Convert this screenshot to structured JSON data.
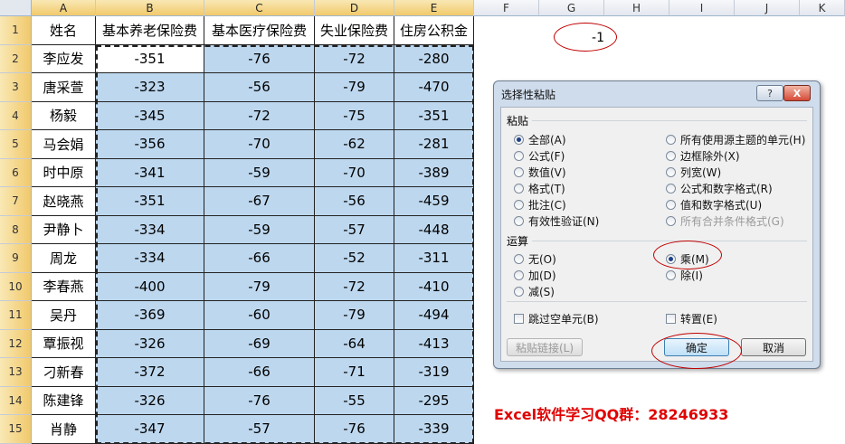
{
  "spreadsheet": {
    "columns": [
      "A",
      "B",
      "C",
      "D",
      "E",
      "F",
      "G",
      "H",
      "I",
      "J",
      "K"
    ],
    "rows": [
      "1",
      "2",
      "3",
      "4",
      "5",
      "6",
      "7",
      "8",
      "9",
      "10",
      "11",
      "12",
      "13",
      "14",
      "15"
    ],
    "headers": [
      "姓名",
      "基本养老保险费",
      "基本医疗保险费",
      "失业保险费",
      "住房公积金"
    ],
    "data": [
      [
        "李应发",
        "-351",
        "-76",
        "-72",
        "-280"
      ],
      [
        "唐采萱",
        "-323",
        "-56",
        "-79",
        "-470"
      ],
      [
        "杨毅",
        "-345",
        "-72",
        "-75",
        "-351"
      ],
      [
        "马会娟",
        "-356",
        "-70",
        "-62",
        "-281"
      ],
      [
        "时中原",
        "-341",
        "-59",
        "-70",
        "-389"
      ],
      [
        "赵晓燕",
        "-351",
        "-67",
        "-56",
        "-459"
      ],
      [
        "尹静卜",
        "-334",
        "-59",
        "-57",
        "-448"
      ],
      [
        "周龙",
        "-334",
        "-66",
        "-52",
        "-311"
      ],
      [
        "李春燕",
        "-400",
        "-79",
        "-72",
        "-410"
      ],
      [
        "吴丹",
        "-369",
        "-60",
        "-79",
        "-494"
      ],
      [
        "覃振视",
        "-326",
        "-69",
        "-64",
        "-413"
      ],
      [
        "刁新春",
        "-372",
        "-66",
        "-71",
        "-319"
      ],
      [
        "陈建锋",
        "-326",
        "-76",
        "-55",
        "-295"
      ],
      [
        "肖静",
        "-347",
        "-57",
        "-76",
        "-339"
      ]
    ],
    "g1_value": "-1",
    "highlight_color": "#bdd7ee"
  },
  "dialog": {
    "title": "选择性粘贴",
    "help_label": "?",
    "close_label": "X",
    "paste_section": "粘贴",
    "paste_left": [
      "全部(A)",
      "公式(F)",
      "数值(V)",
      "格式(T)",
      "批注(C)",
      "有效性验证(N)"
    ],
    "paste_right": [
      "所有使用源主题的单元(H)",
      "边框除外(X)",
      "列宽(W)",
      "公式和数字格式(R)",
      "值和数字格式(U)",
      "所有合并条件格式(G)"
    ],
    "op_section": "运算",
    "op_left": [
      "无(O)",
      "加(D)",
      "减(S)"
    ],
    "op_right": [
      "乘(M)",
      "除(I)"
    ],
    "skip_blanks": "跳过空单元(B)",
    "transpose": "转置(E)",
    "paste_link": "粘贴链接(L)",
    "ok": "确定",
    "cancel": "取消"
  },
  "annotation": "Excel软件学习QQ群：28246933",
  "annotation_color": "#e00000"
}
